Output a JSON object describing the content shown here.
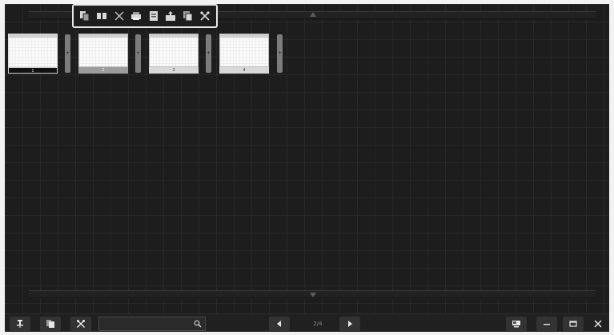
{
  "toolbar": {
    "buttons": [
      {
        "icon": "copy-pages-icon"
      },
      {
        "icon": "two-pages-icon"
      },
      {
        "icon": "delete-x-icon"
      },
      {
        "icon": "print-icon"
      },
      {
        "icon": "document-icon"
      },
      {
        "icon": "export-icon"
      },
      {
        "icon": "duplicate-icon"
      },
      {
        "icon": "tools-icon"
      }
    ]
  },
  "pages": [
    {
      "number": "1",
      "selected": false
    },
    {
      "number": "2",
      "selected": true
    },
    {
      "number": "3",
      "selected": false
    },
    {
      "number": "4",
      "selected": false
    }
  ],
  "insert_label": "+",
  "taskbar": {
    "search": {
      "value": "",
      "placeholder": ""
    },
    "page_indicator": "2/4",
    "icons": {
      "pin": "pin-icon",
      "pages": "pages-stack-icon",
      "tools": "tools-icon",
      "prev": "prev-arrow-icon",
      "next": "next-arrow-icon",
      "display": "display-icon",
      "minimize": "minimize-icon",
      "restore": "restore-window-icon",
      "close": "close-icon"
    }
  },
  "colors": {
    "background": "#1d1d1d",
    "highlight_border": "#e8e8e8",
    "selected_page_label": "#9c9c9c"
  }
}
